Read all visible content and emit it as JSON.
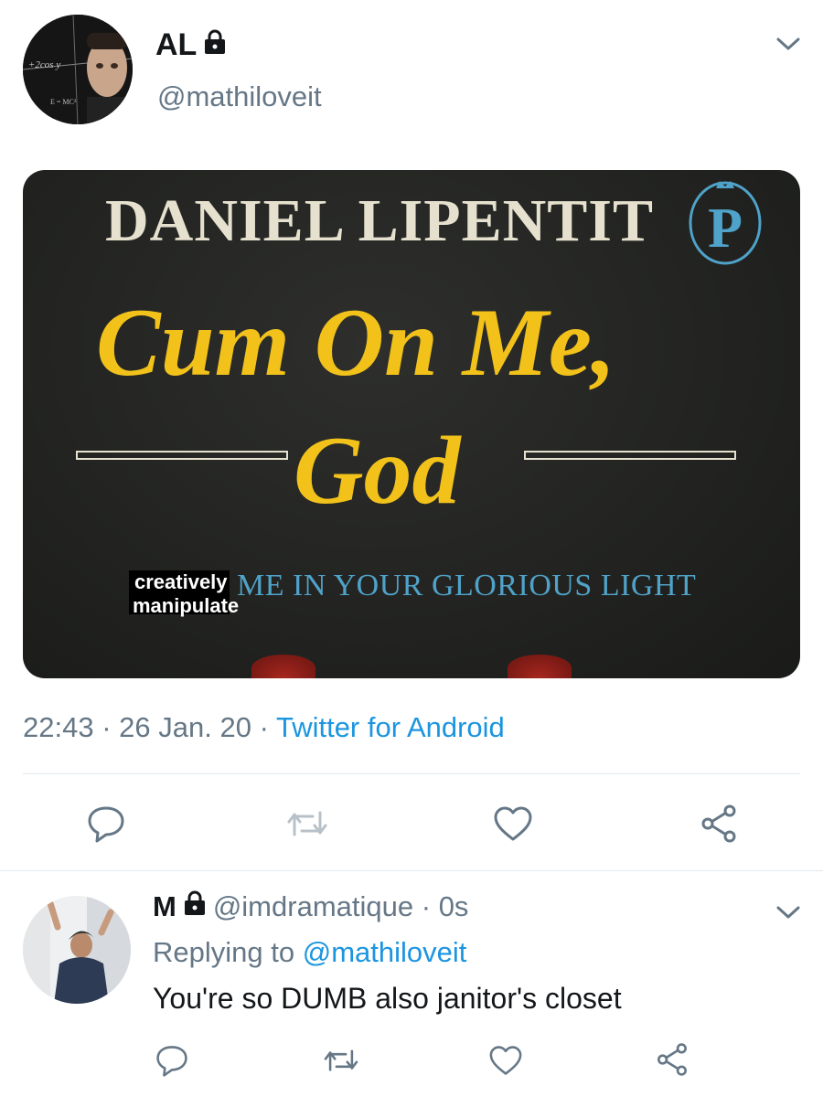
{
  "tweet": {
    "author": {
      "name": "AL",
      "handle": "@mathiloveit",
      "avatar_overlay_texts": [
        "+2cos y",
        "E = MC²"
      ]
    },
    "media": {
      "author": "DANIEL LIPENTIT",
      "title_line1": "Cum On Me,",
      "title_line2": "God",
      "subtitle": "ME IN YOUR GLORIOUS LIGHT",
      "publisher_mark": "P",
      "watermark_line1": "creatively",
      "watermark_line2": "manipulate"
    },
    "meta": {
      "time": "22:43",
      "date": "26 Jan. 20",
      "source": "Twitter for Android",
      "separator": "·"
    },
    "actions": {
      "icons": [
        "reply-icon",
        "retweet-icon",
        "like-icon",
        "share-icon"
      ]
    }
  },
  "reply": {
    "author": {
      "name": "M",
      "handle": "@imdramatique",
      "age": "0s",
      "separator": "·"
    },
    "replying_prefix": "Replying to",
    "replying_to": "@mathiloveit",
    "text": "You're so DUMB also janitor's closet"
  },
  "colors": {
    "link": "#1b95e0",
    "secondary_text": "#657786",
    "primary_text": "#14171a",
    "book_yellow": "#f2c21b",
    "book_blue": "#4fa2c9",
    "book_background": "#232421"
  }
}
